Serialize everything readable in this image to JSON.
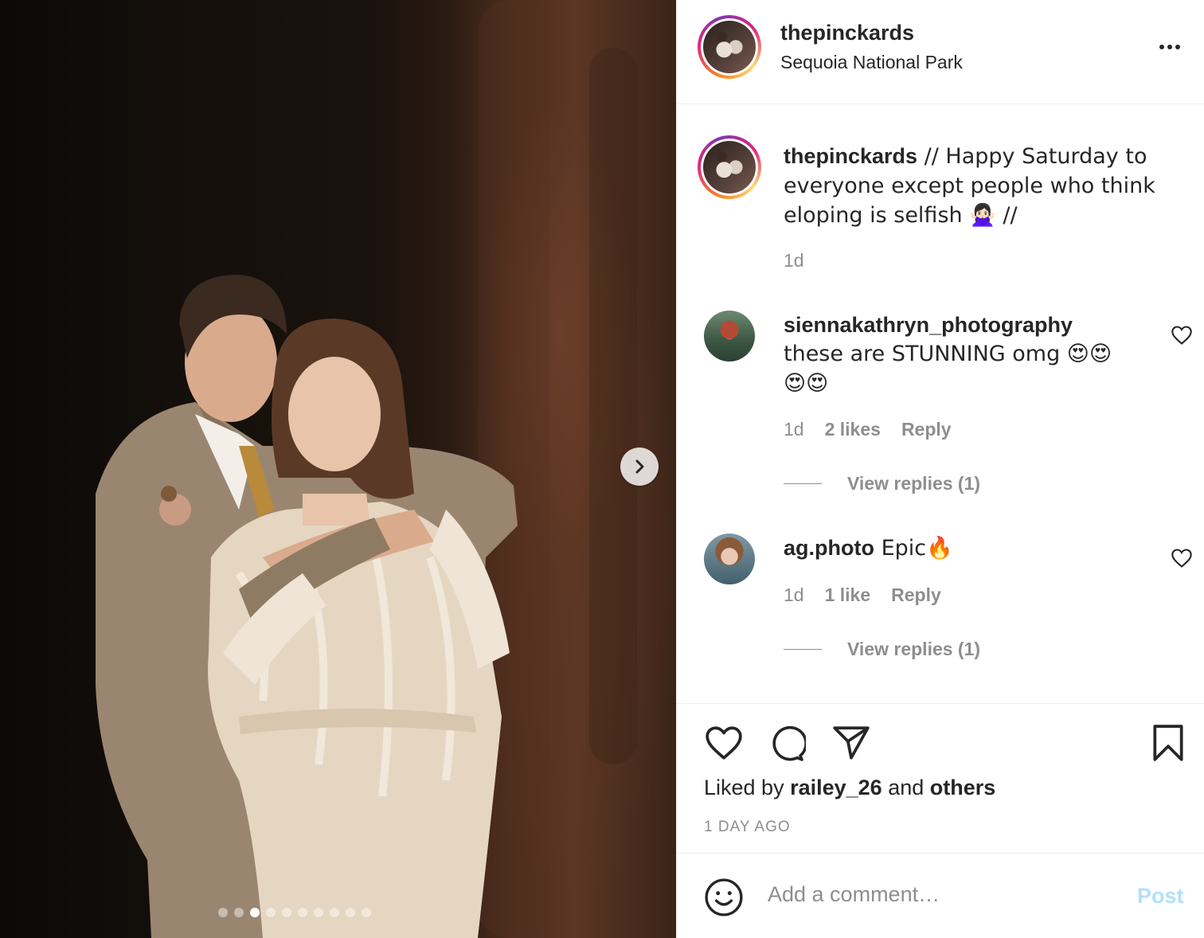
{
  "post": {
    "username": "thepinckards",
    "location": "Sequoia National Park",
    "caption_user": "thepinckards",
    "caption_text": " // Happy Saturday to everyone except people who think eloping is selfish 🙅🏻‍♀️ //",
    "caption_time": "1d",
    "carousel": {
      "total_slides": 10,
      "active_slide": 3
    }
  },
  "comments": [
    {
      "username": "siennakathryn_photography",
      "text": "these are STUNNING omg 😍😍😍😍",
      "time": "1d",
      "likes": "2 likes",
      "reply_label": "Reply",
      "view_replies": "View replies (1)"
    },
    {
      "username": "ag.photo",
      "text": " Epic🔥",
      "time": "1d",
      "likes": "1 like",
      "reply_label": "Reply",
      "view_replies": "View replies (1)"
    }
  ],
  "likes": {
    "prefix": "Liked by ",
    "user": "railey_26",
    "middle": " and ",
    "others": "others"
  },
  "timestamp": "1 DAY AGO",
  "comment_box": {
    "placeholder": "Add a comment…",
    "post_label": "Post",
    "post_color": "#b2dffc"
  },
  "icons": [
    "more-icon",
    "heart-icon",
    "comment-icon",
    "share-icon",
    "bookmark-icon",
    "smiley-icon",
    "chevron-right-icon"
  ]
}
